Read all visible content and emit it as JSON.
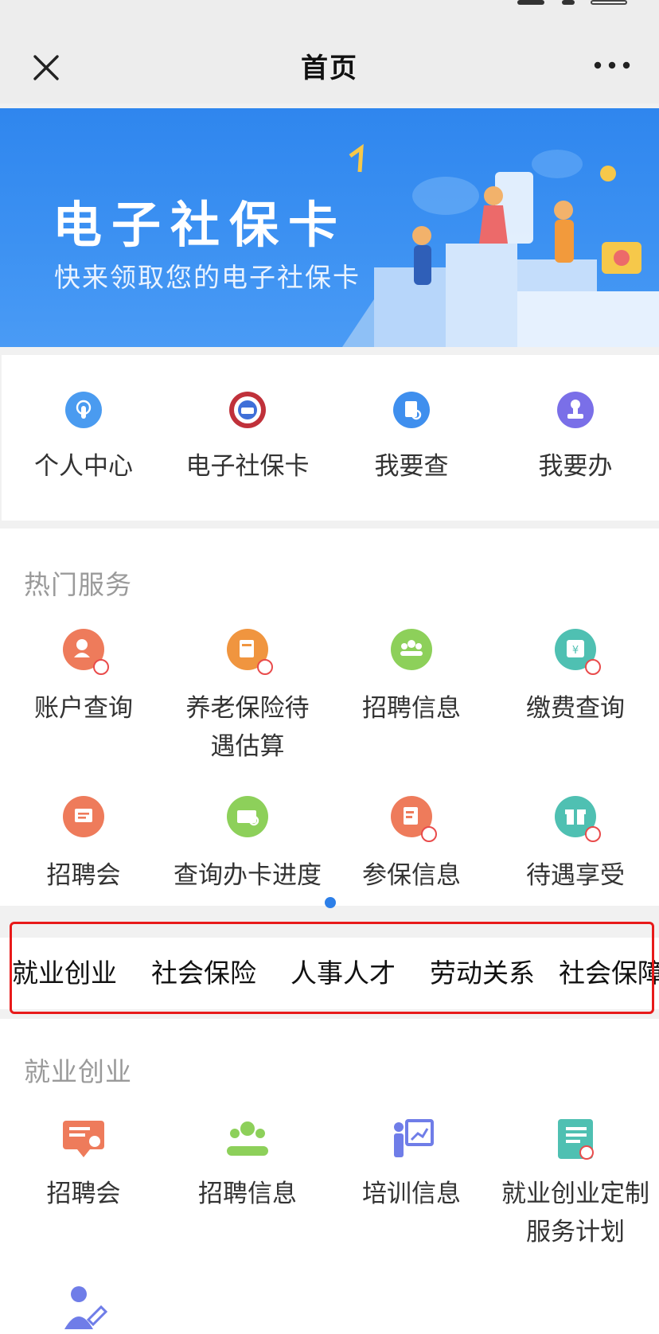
{
  "header": {
    "title": "首页"
  },
  "banner": {
    "title": "电子社保卡",
    "subtitle": "快来领取您的电子社保卡"
  },
  "quick_entries": [
    {
      "label": "个人中心",
      "icon": "finger-touch-icon",
      "color": "#4a9bf0"
    },
    {
      "label": "电子社保卡",
      "icon": "social-security-seal-icon",
      "color": "#c0313a"
    },
    {
      "label": "我要查",
      "icon": "document-search-icon",
      "color": "#3f8fee"
    },
    {
      "label": "我要办",
      "icon": "stamp-icon",
      "color": "#7a6fe8"
    }
  ],
  "hot_services": {
    "title": "热门服务",
    "items": [
      {
        "label": "账户查询",
        "icon": "account-user-icon",
        "color": "#ee7b5b"
      },
      {
        "label": "养老保险待遇估算",
        "icon": "pension-calc-icon",
        "color": "#f0953f"
      },
      {
        "label": "招聘信息",
        "icon": "group-people-icon",
        "color": "#8dd05a"
      },
      {
        "label": "缴费查询",
        "icon": "payment-yen-icon",
        "color": "#4fc0b2"
      },
      {
        "label": "招聘会",
        "icon": "job-fair-board-icon",
        "color": "#ee7b5b"
      },
      {
        "label": "查询办卡进度",
        "icon": "card-progress-icon",
        "color": "#8dd05a"
      },
      {
        "label": "参保信息",
        "icon": "insured-info-icon",
        "color": "#ee7b5b"
      },
      {
        "label": "待遇享受",
        "icon": "gift-icon",
        "color": "#4fc0b2"
      }
    ]
  },
  "category_tabs": [
    "就业创业",
    "社会保险",
    "人事人才",
    "劳动关系",
    "社会保障"
  ],
  "employment_section": {
    "title": "就业创业",
    "items": [
      {
        "label": "招聘会",
        "icon": "job-fair-board-icon",
        "color": "#ee7b5b"
      },
      {
        "label": "招聘信息",
        "icon": "group-people-icon",
        "color": "#8dd05a"
      },
      {
        "label": "培训信息",
        "icon": "training-presenter-icon",
        "color": "#6f7de8"
      },
      {
        "label": "就业创业定制服务计划",
        "icon": "custom-plan-notebook-icon",
        "color": "#4fc0b2"
      },
      {
        "label": "",
        "icon": "person-edit-icon",
        "color": "#6f7de8"
      }
    ]
  },
  "colors": {
    "highlight": "#e81a1a",
    "accent": "#2d7fe8",
    "banner": "#3c91f2"
  }
}
